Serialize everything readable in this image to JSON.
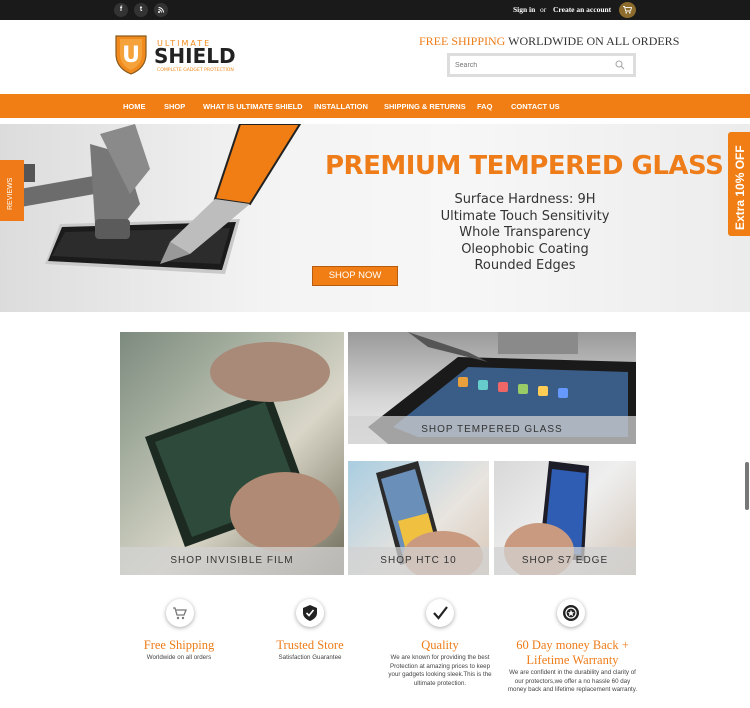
{
  "topbar": {
    "social": [
      {
        "name": "facebook-icon",
        "glyph": "f"
      },
      {
        "name": "twitter-icon",
        "glyph": "t"
      },
      {
        "name": "rss-icon",
        "glyph": "…"
      }
    ],
    "sign_in": "Sign in",
    "or": "or",
    "create_account": "Create an account"
  },
  "header": {
    "logo": {
      "top": "ULTIMATE",
      "main": "SHIELD",
      "tagline": "COMPLETE GADGET PROTECTION"
    },
    "promo_highlight": "FREE SHIPPING",
    "promo_rest": "WORLDWIDE ON ALL ORDERS",
    "search_placeholder": "Search"
  },
  "nav": [
    "HOME",
    "SHOP",
    "WHAT IS ULTIMATE SHIELD",
    "INSTALLATION",
    "SHIPPING & RETURNS",
    "FAQ",
    "CONTACT US"
  ],
  "hero": {
    "reviews_tab": "REVIEWS",
    "extra_tab": "Extra 10% OFF",
    "title": "PREMIUM TEMPERED GLASS",
    "features": [
      "Surface Hardness: 9H",
      "Ultimate Touch Sensitivity",
      "Whole Transparency",
      "Oleophobic Coating",
      "Rounded Edges"
    ],
    "cta": "SHOP NOW"
  },
  "tiles": [
    {
      "label": "SHOP INVISIBLE FILM"
    },
    {
      "label": "SHOP TEMPERED GLASS"
    },
    {
      "label": "SHOP HTC 10"
    },
    {
      "label": "SHOP S7 EDGE"
    }
  ],
  "features": [
    {
      "icon": "cart-icon",
      "title": "Free Shipping",
      "desc": "Worldwide on all orders"
    },
    {
      "icon": "shield-check-icon",
      "title": "Trusted Store",
      "desc": "Satisfaction Guarantee"
    },
    {
      "icon": "checkmark-icon",
      "title": "Quality",
      "desc": "We are known for providing the best Protection at amazing prices to keep your gadgets looking sleek.This is the ultimate protection."
    },
    {
      "icon": "award-badge-icon",
      "title": "60 Day money Back + Lifetime Warranty",
      "desc": "We are confident in the durability and clarity of our protectors,we offer a no hassle 60 day money back and lifetime replacement warranty."
    }
  ],
  "colors": {
    "accent": "#f07e14",
    "topbar": "#1a1a1a",
    "cart": "#8d6b2c"
  }
}
